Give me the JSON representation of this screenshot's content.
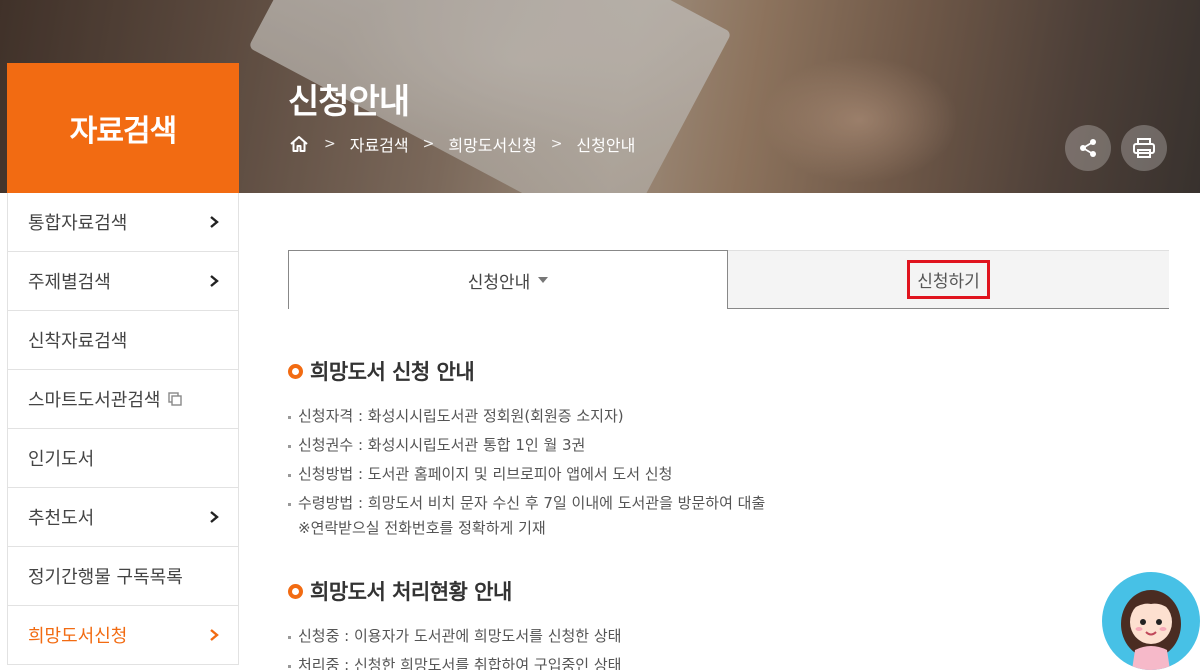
{
  "banner": {
    "title": "신청안내",
    "breadcrumb": [
      "자료검색",
      "희망도서신청",
      "신청안내"
    ],
    "share_icon": "share-icon",
    "print_icon": "print-icon"
  },
  "sidebar": {
    "heading": "자료검색",
    "items": [
      {
        "label": "통합자료검색",
        "arrow": true
      },
      {
        "label": "주제별검색",
        "arrow": true
      },
      {
        "label": "신착자료검색",
        "arrow": false
      },
      {
        "label": "스마트도서관검색",
        "arrow": false,
        "external_icon": "new-window-icon"
      },
      {
        "label": "인기도서",
        "arrow": false
      },
      {
        "label": "추천도서",
        "arrow": true
      },
      {
        "label": "정기간행물 구독목록",
        "arrow": false
      },
      {
        "label": "희망도서신청",
        "arrow": true,
        "active": true
      }
    ],
    "accent_color": "#f26b12"
  },
  "tabs": {
    "active_label": "신청안내",
    "other_label": "신청하기",
    "highlight_color": "#e0141e"
  },
  "sections": [
    {
      "title": "희망도서 신청 안내",
      "items": [
        "신청자격 : 화성시시립도서관 정회원(회원증 소지자)",
        "신청권수 : 화성시시립도서관 통합 1인 월 3권",
        "신청방법 : 도서관 홈페이지 및 리브로피아 앱에서 도서 신청",
        "수령방법 : 희망도서 비치 문자 수신 후 7일 이내에 도서관을 방문하여 대출"
      ],
      "note": "※연락받으실 전화번호를 정확하게 기재"
    },
    {
      "title": "희망도서 처리현황 안내",
      "items": [
        "신청중 : 이용자가 도서관에 희망도서를 신청한 상태",
        "처리중 : 신청한 희망도서를 취합하여 구입중인 상태"
      ]
    }
  ]
}
